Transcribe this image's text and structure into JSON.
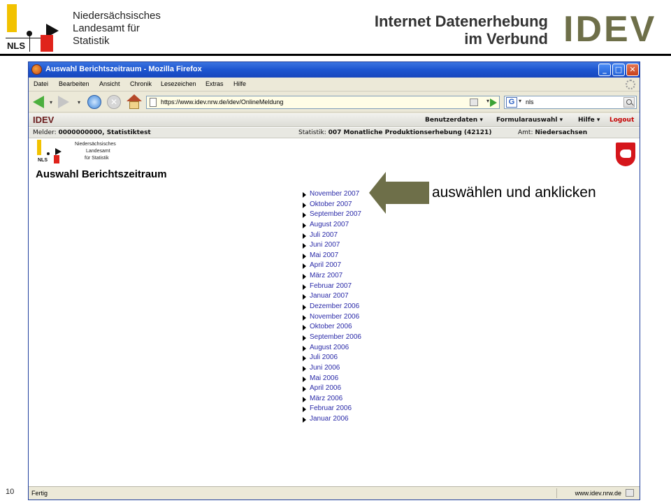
{
  "slide": {
    "org_lines": [
      "Niedersächsisches",
      "Landesamt für",
      "Statistik"
    ],
    "logo_text": "NLS",
    "title_lines": [
      "Internet Datenerhebung",
      "im Verbund"
    ],
    "brand_big": "IDEV",
    "page_number": "10",
    "callout_text": "auswählen und anklicken",
    "accent_color": "#6e6f49"
  },
  "browser": {
    "window_title": "Auswahl Berichtszeitraum - Mozilla Firefox",
    "menu": [
      "Datei",
      "Bearbeiten",
      "Ansicht",
      "Chronik",
      "Lesezeichen",
      "Extras",
      "Hilfe"
    ],
    "url": "https://www.idev.nrw.de/idev/OnlineMeldung",
    "search_value": "nls",
    "status_text": "Fertig",
    "status_domain": "www.idev.nrw.de"
  },
  "app": {
    "brand": "IDEV",
    "menu": {
      "benutzerdaten": "Benutzerdaten ▾",
      "formularauswahl": "Formularauswahl ▾",
      "hilfe": "Hilfe ▾",
      "logout": "Logout"
    },
    "melder_label": "Melder:",
    "melder_value": "0000000000, Statistiktest",
    "statistik_label": "Statistik:",
    "statistik_value": "007 Monatliche Produktionserhebung (42121)",
    "amt_label": "Amt:",
    "amt_value": "Niedersachsen",
    "mini_logo_text": "NLS",
    "mini_org_lines": [
      "Niedersächsisches",
      "Landesamt",
      "für Statistik"
    ],
    "page_title": "Auswahl Berichtszeitraum",
    "periods": [
      "November 2007",
      "Oktober 2007",
      "September 2007",
      "August 2007",
      "Juli 2007",
      "Juni 2007",
      "Mai 2007",
      "April 2007",
      "März 2007",
      "Februar 2007",
      "Januar 2007",
      "Dezember 2006",
      "November 2006",
      "Oktober 2006",
      "September 2006",
      "August 2006",
      "Juli 2006",
      "Juni 2006",
      "Mai 2006",
      "April 2006",
      "März 2006",
      "Februar 2006",
      "Januar 2006"
    ]
  }
}
